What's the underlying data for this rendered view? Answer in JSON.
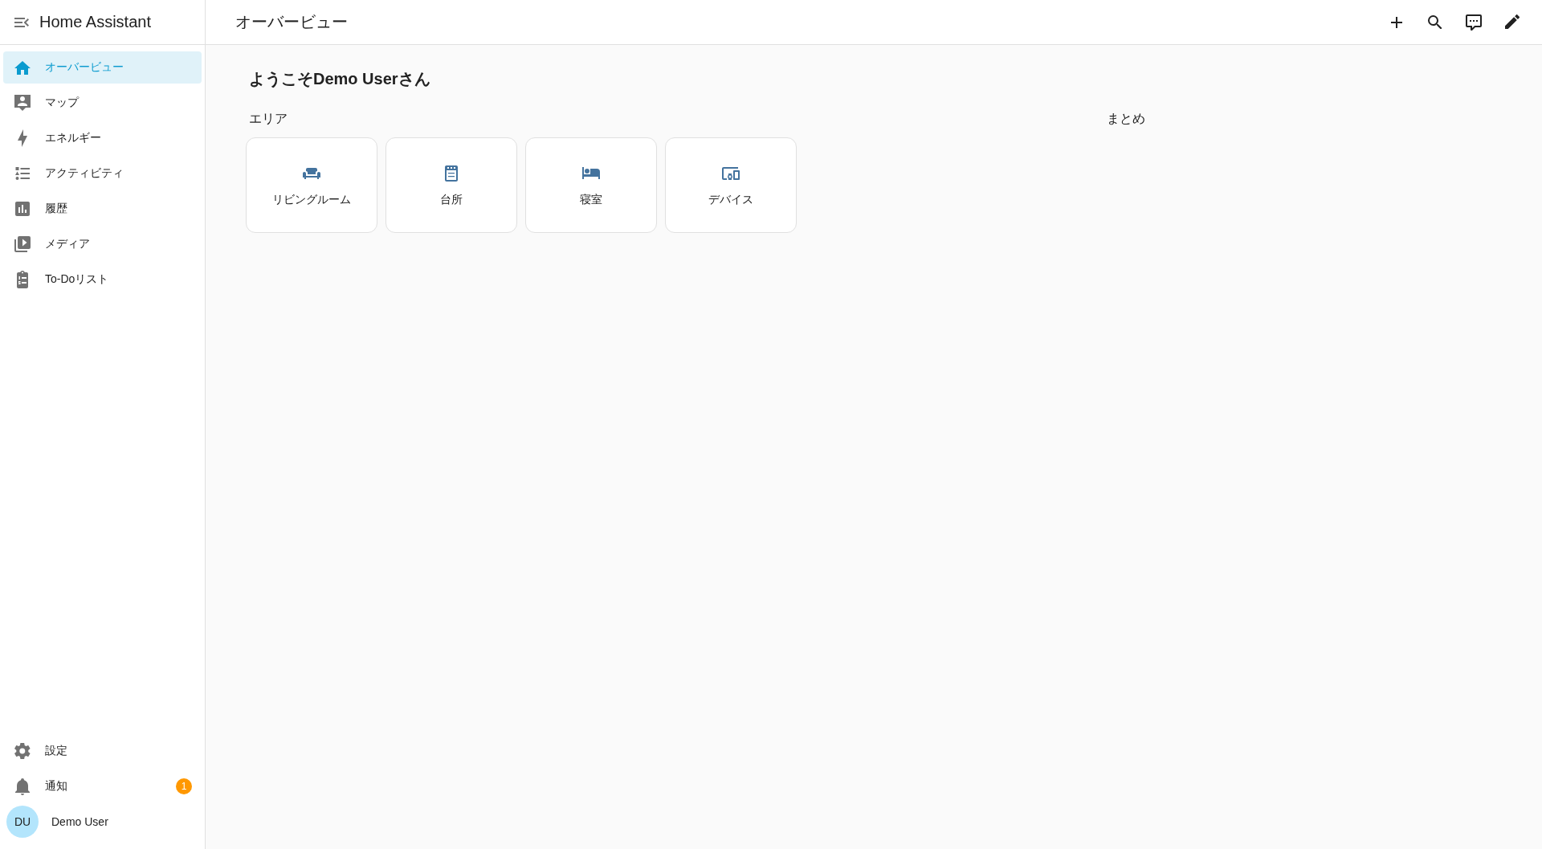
{
  "sidebar": {
    "title": "Home Assistant",
    "items": [
      {
        "label": "オーバービュー",
        "selected": true
      },
      {
        "label": "マップ",
        "selected": false
      },
      {
        "label": "エネルギー",
        "selected": false
      },
      {
        "label": "アクティビティ",
        "selected": false
      },
      {
        "label": "履歴",
        "selected": false
      },
      {
        "label": "メディア",
        "selected": false
      },
      {
        "label": "To-Doリスト",
        "selected": false
      }
    ],
    "footer_items": [
      {
        "label": "設定",
        "selected": false
      },
      {
        "label": "通知",
        "selected": false,
        "badge": "1"
      }
    ],
    "user": {
      "initials": "DU",
      "name": "Demo User"
    }
  },
  "header": {
    "title": "オーバービュー"
  },
  "welcome": "ようこそDemo Userさん",
  "sections": [
    {
      "title": "エリア",
      "cards": [
        {
          "label": "リビングルーム"
        },
        {
          "label": "台所"
        },
        {
          "label": "寝室"
        },
        {
          "label": "デバイス"
        }
      ]
    },
    {
      "title": "まとめ"
    }
  ]
}
